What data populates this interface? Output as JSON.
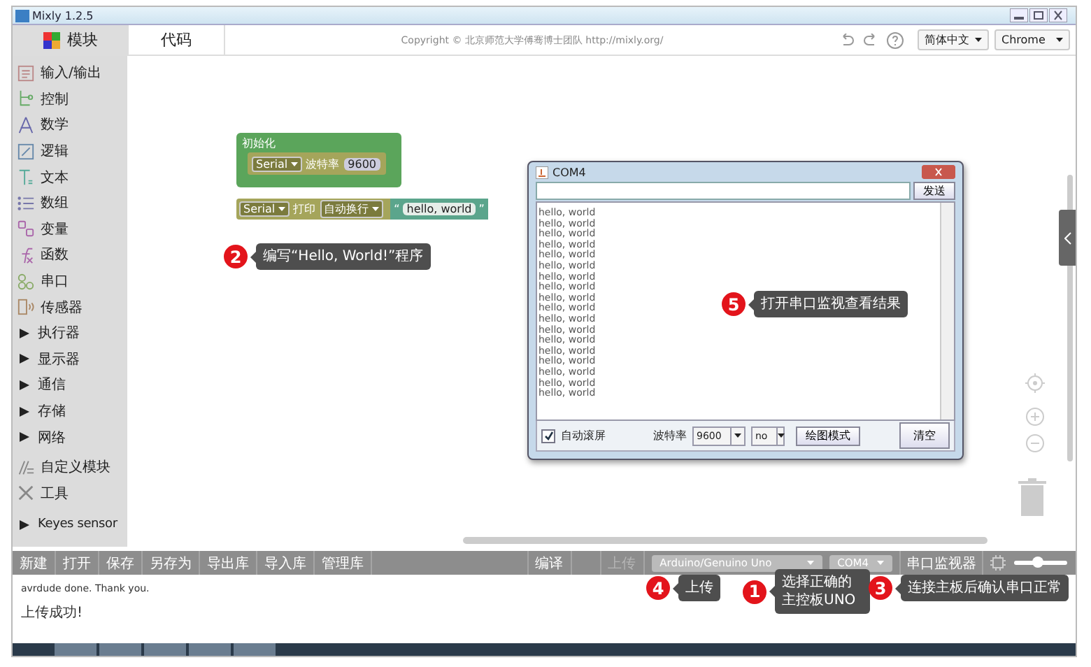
{
  "window": {
    "title": "Mixly 1.2.5"
  },
  "header": {
    "tab": "代码",
    "copyright": "Copyright © 北京师范大学傅骞博士团队 http://mixly.org/",
    "language": "简体中文",
    "browser": "Chrome"
  },
  "sidebar": {
    "header": "模块",
    "items": [
      {
        "label": "输入/输出",
        "kind": "category"
      },
      {
        "label": "控制",
        "kind": "category"
      },
      {
        "label": "数学",
        "kind": "category"
      },
      {
        "label": "逻辑",
        "kind": "category"
      },
      {
        "label": "文本",
        "kind": "category"
      },
      {
        "label": "数组",
        "kind": "category"
      },
      {
        "label": "变量",
        "kind": "category"
      },
      {
        "label": "函数",
        "kind": "category"
      },
      {
        "label": "串口",
        "kind": "category"
      },
      {
        "label": "传感器",
        "kind": "category"
      },
      {
        "label": "执行器",
        "kind": "group"
      },
      {
        "label": "显示器",
        "kind": "group"
      },
      {
        "label": "通信",
        "kind": "group"
      },
      {
        "label": "存储",
        "kind": "group"
      },
      {
        "label": "网络",
        "kind": "group"
      },
      {
        "label": "自定义模块",
        "kind": "category"
      },
      {
        "label": "工具",
        "kind": "category"
      },
      {
        "label": "Keyes sensor",
        "kind": "group"
      }
    ]
  },
  "blocks": {
    "setup": {
      "label": "初始化",
      "serial": "Serial",
      "baud_label": "波特率",
      "baud": "9600"
    },
    "print": {
      "serial": "Serial",
      "action": "打印",
      "mode": "自动换行",
      "open_quote": "“",
      "text": "hello, world",
      "close_quote": "”"
    }
  },
  "serial_monitor": {
    "title": "COM4",
    "send": "发送",
    "lines": [
      "hello, world",
      "hello, world",
      "hello, world",
      "hello, world",
      "hello, world",
      "hello, world",
      "hello, world",
      "hello, world",
      "hello, world",
      "hello, world",
      "hello, world",
      "hello, world",
      "hello, world",
      "hello, world",
      "hello, world",
      "hello, world",
      "hello, world",
      "hello, world"
    ],
    "autoscroll": {
      "label": "自动滚屏",
      "checked": true
    },
    "baud_label": "波特率",
    "baud": "9600",
    "line_ending": "no",
    "plot": "绘图模式",
    "clear": "清空"
  },
  "toolbar": {
    "file_buttons": [
      "新建",
      "打开",
      "保存",
      "另存为",
      "导出库",
      "导入库",
      "管理库"
    ],
    "compile": "编译",
    "upload": {
      "label": "上传",
      "disabled": true
    },
    "board": "Arduino/Genuino Uno",
    "port": "COM4",
    "monitor": "串口监视器",
    "zoom": {
      "level": 0.45
    }
  },
  "console": {
    "lines": [
      "avrdude done.  Thank you.",
      "上传成功!"
    ]
  },
  "callouts": [
    {
      "number": "2",
      "text": "编写“Hello, World!”程序"
    },
    {
      "number": "5",
      "text": "打开串口监视查看结果"
    },
    {
      "number": "4",
      "text": "上传"
    },
    {
      "number": "1",
      "text": "选择正确的主控板UNO"
    },
    {
      "number": "3",
      "text": "连接主板后确认串口正常"
    }
  ]
}
